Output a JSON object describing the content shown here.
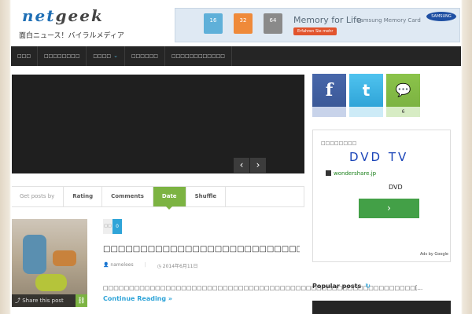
{
  "header": {
    "logo_net": "net",
    "logo_geek": "geek",
    "tagline": "面白ニュース！バイラルメディア"
  },
  "banner": {
    "card1_size": "16",
    "card2_size": "32",
    "card3_size": "64",
    "chip_label": "SAMSUNG",
    "memory_text": "Memory for Life",
    "sub_text": "Samsung Memory Card",
    "cta": "Erfahren Sie mehr",
    "brand": "SAMSUNG"
  },
  "nav": {
    "items": [
      "□□□",
      "□□□□□□□□",
      "□□□□",
      "□□□□□□",
      "□□□□□□□□□□□□"
    ],
    "chevron": "⌄"
  },
  "slider": {
    "prev": "‹",
    "next": "›"
  },
  "tabs": {
    "get_by": "Get posts by",
    "rating": "Rating",
    "comments": "Comments",
    "date": "Date",
    "shuffle": "Shuffle"
  },
  "post": {
    "stat_a": "□□",
    "stat_b": "0",
    "title": "□□□□□□□□□□□□□□□□□□□□□□□□□□□□□□□□□□□□□□□□□□□□□",
    "author": "namelees",
    "date": "2014年6月11日",
    "excerpt": "□□□□□□□□□□□□□□□□□□□□□□□□□□□□□□□□□□□□□□□□□□□□□□□□□□□□□□□□□□□□[...",
    "more": "Continue Reading »",
    "share": "Share this post"
  },
  "social": {
    "facebook_icon": "f",
    "twitter_icon": "t",
    "comment_icon": "💬",
    "comment_count": "6"
  },
  "ad": {
    "heading": "□□□□□□□□",
    "dvd_tv": "DVD TV",
    "source": "wondershare.jp",
    "dvd": "DVD",
    "button": "›",
    "choices": "Ads by Google"
  },
  "sidebar": {
    "popular": "Popular posts",
    "refresh": "↻"
  }
}
